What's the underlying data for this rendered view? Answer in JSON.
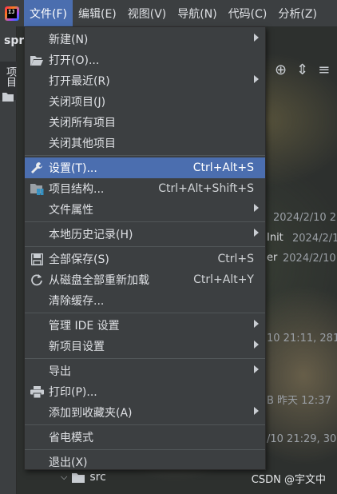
{
  "menubar": {
    "items": [
      {
        "label": "文件",
        "mnemonic": "F",
        "active": true
      },
      {
        "label": "编辑",
        "mnemonic": "E"
      },
      {
        "label": "视图",
        "mnemonic": "V"
      },
      {
        "label": "导航",
        "mnemonic": "N"
      },
      {
        "label": "代码",
        "mnemonic": "C"
      },
      {
        "label": "分析",
        "mnemonic": "Z"
      }
    ]
  },
  "left_strip": {
    "project_tab": "项目",
    "project_name": "spr"
  },
  "file_menu": {
    "new": {
      "label": "新建(N)"
    },
    "open": {
      "label": "打开(O)..."
    },
    "recent": {
      "label": "打开最近(R)"
    },
    "close_project": {
      "label": "关闭项目(J)"
    },
    "close_all": {
      "label": "关闭所有项目"
    },
    "close_others": {
      "label": "关闭其他项目"
    },
    "settings": {
      "label": "设置(T)...",
      "shortcut": "Ctrl+Alt+S",
      "selected": true
    },
    "project_structure": {
      "label": "项目结构...",
      "shortcut": "Ctrl+Alt+Shift+S"
    },
    "file_properties": {
      "label": "文件属性"
    },
    "local_history": {
      "label": "本地历史记录(H)"
    },
    "save_all": {
      "label": "全部保存(S)",
      "shortcut": "Ctrl+S"
    },
    "reload": {
      "label": "从磁盘全部重新加载",
      "shortcut": "Ctrl+Alt+Y"
    },
    "invalidate": {
      "label": "清除缓存..."
    },
    "manage_ide": {
      "label": "管理 IDE 设置"
    },
    "new_project_settings": {
      "label": "新项目设置"
    },
    "export": {
      "label": "导出"
    },
    "print": {
      "label": "打印(P)..."
    },
    "add_favorites": {
      "label": "添加到收藏夹(A)"
    },
    "power_save": {
      "label": "省电模式"
    },
    "exit": {
      "label": "退出(X)"
    }
  },
  "background": {
    "t1": "2024/2/10 2",
    "t2": "Init",
    "t3": "2024/2/1",
    "t4": "er",
    "t5": "2024/2/10",
    "t6": "10 21:11, 281",
    "t7": "B 昨天 12:37",
    "t8": "/10 21:29, 303",
    "tree_src": "src"
  },
  "watermark": "CSDN @宇文中",
  "colors": {
    "menu_bg": "#3c3f41",
    "selection": "#4b6eaf",
    "text": "#dfe1e5"
  }
}
